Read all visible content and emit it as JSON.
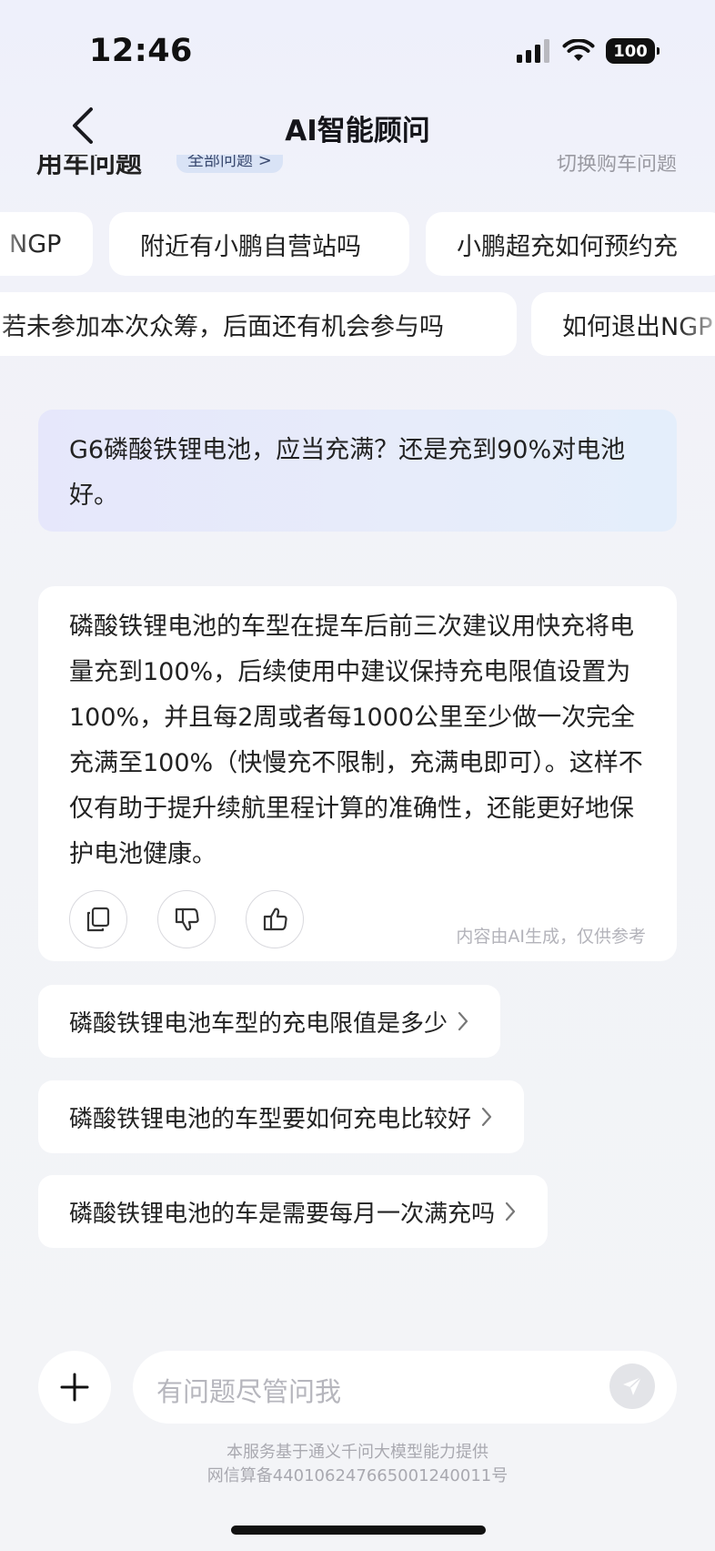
{
  "status_bar": {
    "time": "12:46",
    "battery": "100"
  },
  "nav": {
    "title": "AI智能顾问"
  },
  "clipped_header": {
    "left": "用车问题",
    "badge": "全部问题 >",
    "right": "切换购车问题"
  },
  "chip_rows": [
    [
      "NGP",
      "附近有小鹏自营站吗",
      "小鹏超充如何预约充"
    ],
    [
      "若未参加本次众筹，后面还有机会参与吗",
      "如何退出NGP"
    ]
  ],
  "question": "G6磷酸铁锂电池，应当充满？还是充到90%对电池好。",
  "answer": {
    "text": "磷酸铁锂电池的车型在提车后前三次建议用快充将电量充到100%，后续使用中建议保持充电限值设置为100%，并且每2周或者每1000公里至少做一次完全充满至100%（快慢充不限制，充满电即可）。这样不仅有助于提升续航里程计算的准确性，还能更好地保护电池健康。",
    "disclaimer": "内容由AI生成，仅供参考"
  },
  "suggestions": [
    "磷酸铁锂电池车型的充电限值是多少",
    "磷酸铁锂电池的车型要如何充电比较好",
    "磷酸铁锂电池的车是需要每月一次满充吗"
  ],
  "input": {
    "placeholder": "有问题尽管问我"
  },
  "footer": {
    "line1": "本服务基于通义千问大模型能力提供",
    "line2": "网信算备440106247665001240011号"
  }
}
